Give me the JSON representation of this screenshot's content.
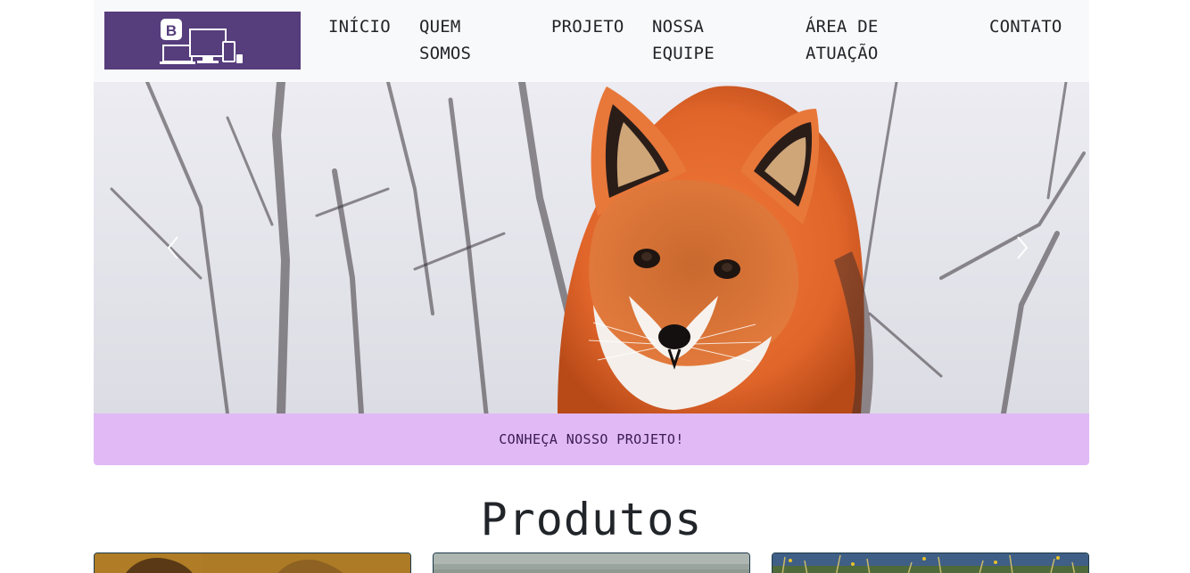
{
  "navbar": {
    "brand_icon": "bootstrap-devices-logo",
    "items": [
      {
        "label": "INÍCIO"
      },
      {
        "label": "QUEM SOMOS"
      },
      {
        "label": "PROJETO"
      },
      {
        "label": "NOSSA EQUIPE"
      },
      {
        "label": "ÁREA DE ATUAÇÃO"
      },
      {
        "label": "CONTATO"
      }
    ]
  },
  "carousel": {
    "prev_icon": "chevron-left-icon",
    "next_icon": "chevron-right-icon"
  },
  "cta": {
    "label": "CONHEÇA NOSSO PROJETO!"
  },
  "products": {
    "heading": "Produtos"
  },
  "colors": {
    "brand_bg": "#563d7c",
    "navbar_bg": "#f8f9fa",
    "cta_bg": "#e0b9f5",
    "text": "#212529"
  }
}
